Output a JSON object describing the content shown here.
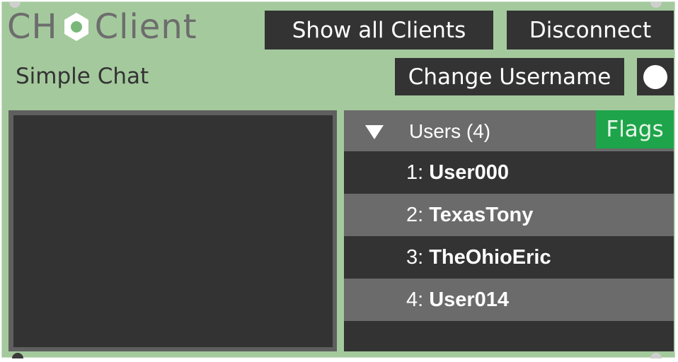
{
  "logo": {
    "prefix": "CH",
    "suffix": "Client",
    "icon": "hex-nut-icon",
    "icon_color": "#7ab87a"
  },
  "subtitle": "Simple Chat",
  "buttons": {
    "show_all_clients": "Show all Clients",
    "disconnect": "Disconnect",
    "change_username": "Change Username"
  },
  "toggle": {
    "icon": "toggle-knob-icon",
    "state": "on"
  },
  "users": {
    "header": "Users (4)",
    "collapse_icon": "triangle-down-icon",
    "flags_label": "Flags",
    "list": [
      {
        "num": "1:",
        "name": "User000"
      },
      {
        "num": "2:",
        "name": "TexasTony"
      },
      {
        "num": "3:",
        "name": "TheOhioEric"
      },
      {
        "num": "4:",
        "name": "User014"
      }
    ]
  },
  "colors": {
    "panel_bg": "#a4c99d",
    "dark": "#333333",
    "row_alt": "#6b6b6b",
    "flags_green": "#1ea44a"
  }
}
